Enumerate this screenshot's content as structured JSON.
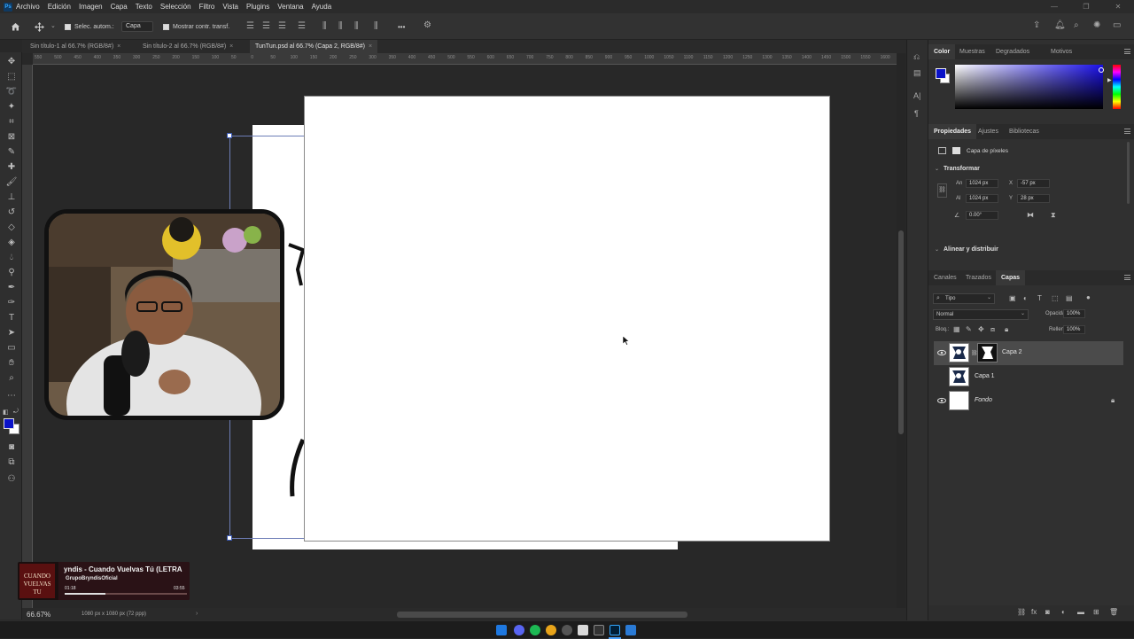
{
  "app": {
    "logo_text": "Ps",
    "menu": [
      "Archivo",
      "Edición",
      "Imagen",
      "Capa",
      "Texto",
      "Selección",
      "Filtro",
      "Vista",
      "Plugins",
      "Ventana",
      "Ayuda"
    ]
  },
  "options": {
    "auto_select_label": "Selec. autom.:",
    "auto_select_value": "Capa",
    "show_transform_label": "Mostrar contr. transf.",
    "more_label": "•••"
  },
  "tabs": [
    {
      "label": "Sin título-1 al 66.7% (RGB/8#)",
      "active": false
    },
    {
      "label": "Sin título-2 al 66.7% (RGB/8#)",
      "active": false
    },
    {
      "label": "TunTun.psd al 66.7% (Capa 2, RGB/8#)",
      "active": true
    }
  ],
  "tab_close": "×",
  "ruler_labels": [
    "550",
    "500",
    "450",
    "400",
    "350",
    "300",
    "250",
    "200",
    "150",
    "100",
    "50",
    "0",
    "50",
    "100",
    "150",
    "200",
    "250",
    "300",
    "350",
    "400",
    "450",
    "500",
    "550",
    "600",
    "650",
    "700",
    "750",
    "800",
    "850",
    "900",
    "950",
    "1000",
    "1050",
    "1100",
    "1150",
    "1200",
    "1250",
    "1300",
    "1350",
    "1400",
    "1450",
    "1500",
    "1550",
    "1600"
  ],
  "status": {
    "zoom": "66.67%",
    "doc_info": "1080 px x 1080 px (72 ppp)"
  },
  "color_panel": {
    "tabs": [
      "Color",
      "Muestras",
      "Degradados",
      "Motivos"
    ],
    "foreground": "#0a12c8",
    "background": "#ffffff"
  },
  "properties_panel": {
    "tabs": [
      "Propiedades",
      "Ajustes",
      "Bibliotecas"
    ],
    "layer_kind": "Capa de píxeles",
    "transform_title": "Transformar",
    "w_label": "An",
    "w_value": "1024 px",
    "h_label": "Al",
    "h_value": "1024 px",
    "x_label": "X",
    "x_value": "-57 px",
    "y_label": "Y",
    "y_value": "28 px",
    "angle_value": "0.00°",
    "align_title": "Alinear y distribuir"
  },
  "layers_panel": {
    "tabs": [
      "Canales",
      "Trazados",
      "Capas"
    ],
    "filter_label": "Tipo",
    "blend_mode": "Normal",
    "opacity_label": "Opacidad:",
    "opacity_value": "100%",
    "lock_label": "Bloq.:",
    "fill_label": "Relleno:",
    "fill_value": "100%",
    "layers": [
      {
        "name": "Capa 2",
        "visible": true,
        "selected": true
      },
      {
        "name": "Capa 1",
        "visible": false,
        "selected": false
      },
      {
        "name": "Fondo",
        "visible": true,
        "selected": false,
        "locked": true
      }
    ]
  },
  "music": {
    "cover_text": "CUANDO VUELVAS TU",
    "title": "yndis - Cuando Vuelvas Tú (LETRA",
    "channel": "GrupoBryndisOficial",
    "elapsed": "01:18",
    "duration": "03:55",
    "progress": 0.33
  },
  "colors": {
    "accent_blue": "#0a12c8",
    "ps_blue": "#33a8ff"
  }
}
